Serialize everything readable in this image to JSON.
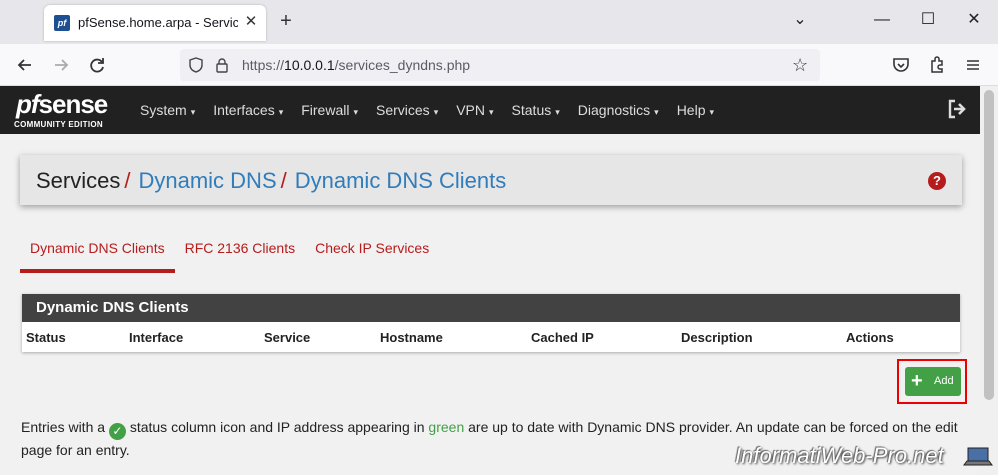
{
  "browser": {
    "tab_title": "pfSense.home.arpa - Services: D",
    "favicon_text": "pf",
    "tab_close": "✕",
    "new_tab": "+",
    "url_prefix": "https://",
    "url_host": "10.0.0.1",
    "url_path": "/services_dyndns.php",
    "window_controls": [
      "⌄",
      "—",
      "☐",
      "✕"
    ]
  },
  "pfsense": {
    "logo_pf": "pf",
    "logo_sense": "sense",
    "logo_subtitle": "COMMUNITY EDITION",
    "menu": [
      "System",
      "Interfaces",
      "Firewall",
      "Services",
      "VPN",
      "Status",
      "Diagnostics",
      "Help"
    ],
    "caret": "▾"
  },
  "breadcrumb": {
    "root": "Services",
    "level1": "Dynamic DNS",
    "level2": "Dynamic DNS Clients",
    "separator": "/",
    "help_icon": "?"
  },
  "tabs": [
    {
      "label": "Dynamic DNS Clients",
      "active": true
    },
    {
      "label": "RFC 2136 Clients",
      "active": false
    },
    {
      "label": "Check IP Services",
      "active": false
    }
  ],
  "table": {
    "title": "Dynamic DNS Clients",
    "columns": [
      "Status",
      "Interface",
      "Service",
      "Hostname",
      "Cached IP",
      "Description",
      "Actions"
    ]
  },
  "add_button": {
    "label": "Add",
    "icon": "+"
  },
  "info": {
    "part1": "Entries with a ",
    "check_icon": "✓",
    "part2": " status column icon and IP address appearing in ",
    "green_word": "green",
    "part3": " are up to date with Dynamic DNS provider. An update can be forced on the edit page for an entry."
  },
  "watermark": "InformatiWeb-Pro.net",
  "colors": {
    "header_bg": "#212121",
    "accent_red": "#b71c1c",
    "link_blue": "#317cba",
    "success_green": "#43a047",
    "panel_head": "#424242"
  }
}
